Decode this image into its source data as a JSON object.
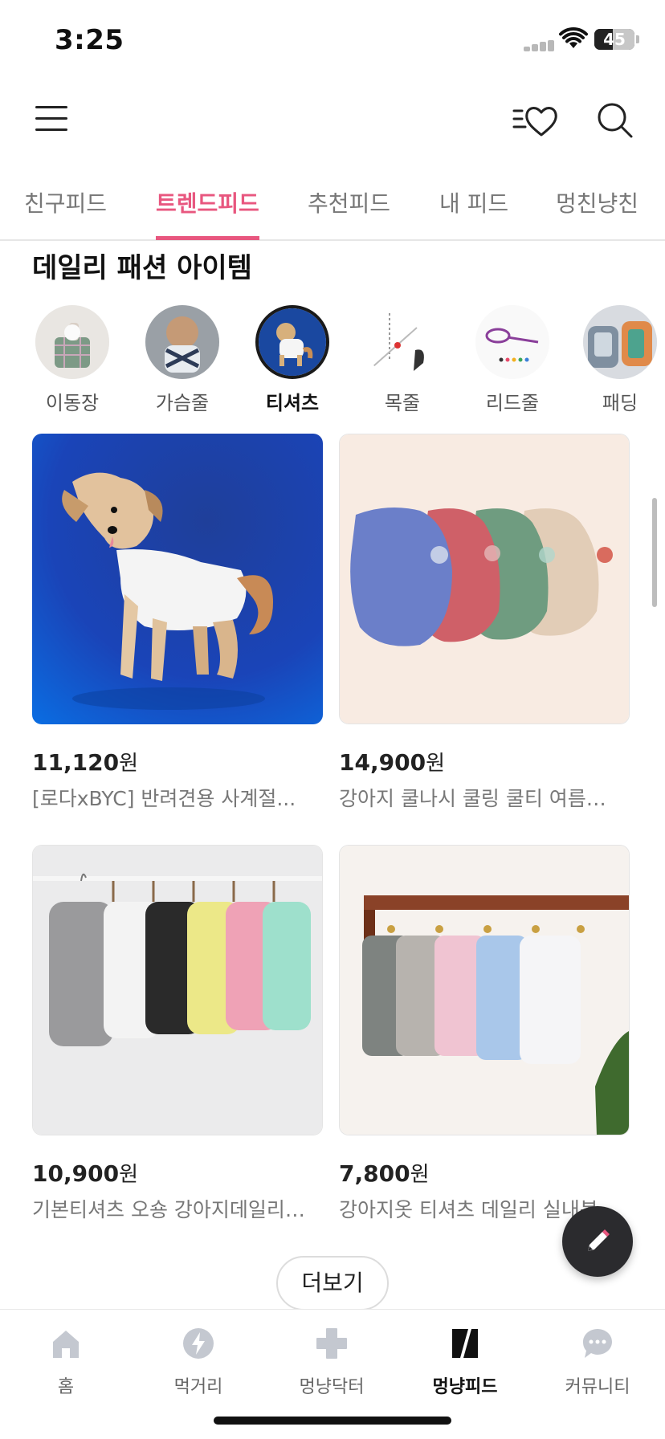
{
  "status": {
    "time": "3:25",
    "battery": "45",
    "battery_level": 0.45
  },
  "header": {
    "menu_icon": "hamburger-menu-icon",
    "wishlist_icon": "heart-list-icon",
    "search_icon": "search-icon"
  },
  "tabs": [
    {
      "label": "친구피드",
      "active": false
    },
    {
      "label": "트렌드피드",
      "active": true
    },
    {
      "label": "추천피드",
      "active": false
    },
    {
      "label": "내 피드",
      "active": false
    },
    {
      "label": "멍친냥친",
      "active": false
    }
  ],
  "section": {
    "title": "데일리 패션 아이템"
  },
  "categories": [
    {
      "label": "이동장",
      "selected": false
    },
    {
      "label": "가슴줄",
      "selected": false
    },
    {
      "label": "티셔츠",
      "selected": true
    },
    {
      "label": "목줄",
      "selected": false
    },
    {
      "label": "리드줄",
      "selected": false
    },
    {
      "label": "패딩",
      "selected": false
    }
  ],
  "products": [
    {
      "price": "11,120",
      "unit": "원",
      "title": "[로다xBYC] 반려견용 사계절..."
    },
    {
      "price": "14,900",
      "unit": "원",
      "title": "강아지 쿨나시 쿨링 쿨티 여름…"
    },
    {
      "price": "10,900",
      "unit": "원",
      "title": "기본티셔츠 오숑 강아지데일리…"
    },
    {
      "price": "7,800",
      "unit": "원",
      "title": "강아지옷 티셔츠 데일리 실내복…"
    }
  ],
  "more_button": "더보기",
  "fab_icon": "pencil-icon",
  "bottom_nav": [
    {
      "label": "홈",
      "icon": "home-icon",
      "active": false
    },
    {
      "label": "먹거리",
      "icon": "lightning-icon",
      "active": false
    },
    {
      "label": "멍냥닥터",
      "icon": "medical-cross-icon",
      "active": false
    },
    {
      "label": "멍냥피드",
      "icon": "feed-icon",
      "active": true
    },
    {
      "label": "커뮤니티",
      "icon": "chat-bubble-icon",
      "active": false
    }
  ],
  "colors": {
    "accent": "#e8577f",
    "fab": "#2b2b2e",
    "nav_inactive_icon": "#c4c8d0"
  }
}
